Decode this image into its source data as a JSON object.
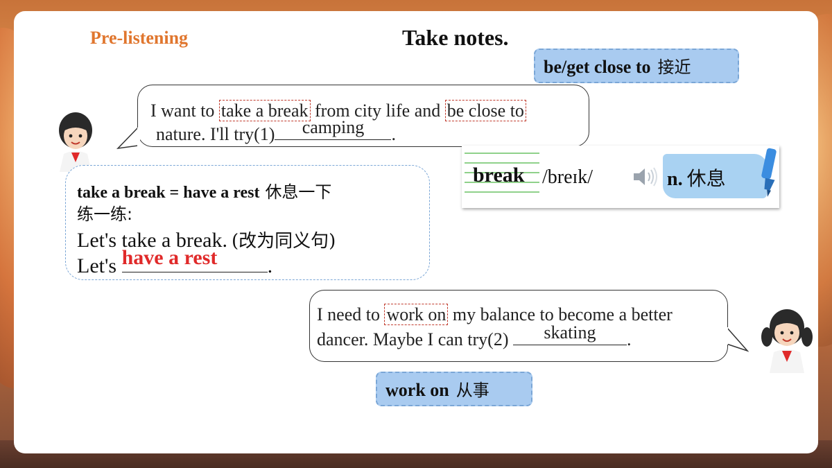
{
  "header": {
    "section_label": "Pre-listening",
    "title": "Take notes."
  },
  "chips": {
    "be_close": {
      "en": "be/get close to",
      "cn": "接近"
    },
    "work_on": {
      "en": "work on",
      "cn": "从事"
    }
  },
  "bubble1": {
    "pre": "I want to ",
    "phrase1": "take a break",
    "mid": " from city life and ",
    "phrase2": "be close to",
    "line2_pre": "nature. I'll try(1)",
    "answer1": "camping",
    "line2_post": "."
  },
  "note": {
    "phrase": "take a break = have a rest",
    "phrase_cn": "休息一下",
    "practice": "练一练:",
    "sentence": "Let's take a break.",
    "instruction": "(改为同义句)",
    "rewrite_pre": "Let's",
    "rewrite_answer": "have a rest",
    "rewrite_post": "."
  },
  "word_card": {
    "word": "break",
    "ipa": "/breɪk/",
    "pos": "n.",
    "meaning": "休息",
    "speaker_icon": "speaker-icon",
    "marker_icon": "highlighter-icon"
  },
  "bubble2": {
    "pre": "I need to ",
    "phrase": "work on",
    "post": " my balance to become a better",
    "line2_pre": "dancer. Maybe I can try(2) ",
    "answer2": "skating",
    "line2_post": "."
  },
  "colors": {
    "section_label": "#e0762e",
    "chip_bg": "#a9cbf0",
    "answer_red": "#e02a2a",
    "phrase_box": "#c0392b"
  }
}
